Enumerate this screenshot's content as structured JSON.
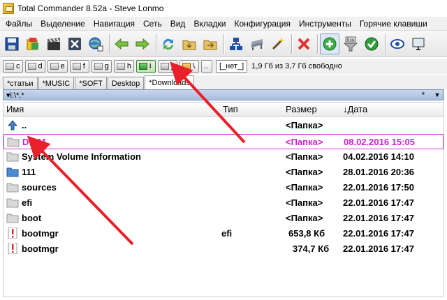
{
  "window": {
    "title": "Total Commander 8.52a - Steve Lonmo"
  },
  "menu": [
    "Файлы",
    "Выделение",
    "Навигация",
    "Сеть",
    "Вид",
    "Вкладки",
    "Конфигурация",
    "Инструменты",
    "Горячие клавиши"
  ],
  "toolbar": {
    "icons": [
      "floppy-save-icon",
      "pack-icon",
      "film-clapper-icon",
      "close-x-icon",
      "globe-icon",
      "arrow-left-icon",
      "arrow-right-icon",
      "sync-refresh-icon",
      "folder-down-icon",
      "folder-right-icon",
      "network-icon",
      "bench-icon",
      "wand-icon",
      "delete-x-icon",
      "add-plus-icon",
      "exe-funnel-icon",
      "check-icon",
      "eye-icon",
      "monitor-icon"
    ]
  },
  "drives": {
    "buttons": [
      "c",
      "d",
      "e",
      "f",
      "g",
      "h",
      "i",
      "j"
    ],
    "active": "i",
    "specials": [
      "\\",
      ".."
    ],
    "label_select": "[_нет_]",
    "free_space": "1,9 Гб из 3,7 Гб свободно"
  },
  "tabs": [
    "*статьи",
    "*MUSIC",
    "*SOFT",
    "Desktop",
    "*Downloads"
  ],
  "active_tab": "*Downloads",
  "path": {
    "text": "▾i:\\*.*",
    "history_label": "*",
    "dropdown_label": "▼"
  },
  "columns": {
    "name": "Имя",
    "type": "Тип",
    "size": "Размер",
    "date": "↓Дата"
  },
  "files": [
    {
      "icon": "up-arrow-icon",
      "name": "..",
      "type": "",
      "size": "<Папка>",
      "date": ""
    },
    {
      "icon": "folder-icon",
      "name": "DCIM",
      "type": "",
      "size": "<Папка>",
      "date": "08.02.2016 15:05",
      "cursor": true
    },
    {
      "icon": "folder-icon",
      "name": "System Volume Information",
      "type": "",
      "size": "<Папка>",
      "date": "04.02.2016 14:10"
    },
    {
      "icon": "folder-blue-icon",
      "name": "111",
      "type": "",
      "size": "<Папка>",
      "date": "28.01.2016 20:36"
    },
    {
      "icon": "folder-icon",
      "name": "sources",
      "type": "",
      "size": "<Папка>",
      "date": "22.01.2016 17:50"
    },
    {
      "icon": "folder-icon",
      "name": "efi",
      "type": "",
      "size": "<Папка>",
      "date": "22.01.2016 17:47"
    },
    {
      "icon": "folder-icon",
      "name": "boot",
      "type": "",
      "size": "<Папка>",
      "date": "22.01.2016 17:47"
    },
    {
      "icon": "file-exclaim-icon",
      "name": "bootmgr",
      "type": "efi",
      "size": "653,8 Кб",
      "date": "22.01.2016 17:47"
    },
    {
      "icon": "file-exclaim-icon",
      "name": "bootmgr",
      "type": "",
      "size": "374,7 Кб",
      "date": "22.01.2016 17:47"
    }
  ],
  "colors": {
    "highlight": "#cc22cc",
    "annotation_arrow": "#e8202a",
    "path_bar": "#b5c7e3"
  }
}
